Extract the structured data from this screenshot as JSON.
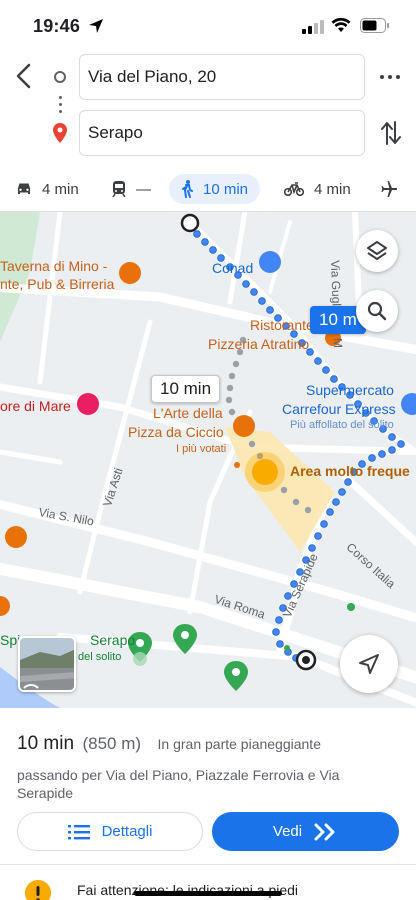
{
  "status_bar": {
    "time": "19:46"
  },
  "search": {
    "origin": "Via del Piano, 20",
    "destination": "Serapo"
  },
  "modes": {
    "car": "4 min",
    "transit": "—",
    "walk": "10 min",
    "bike": "4 min"
  },
  "map": {
    "route_time_main": "10 min",
    "route_time_alt": "10 m",
    "labels": {
      "taverna_1": "Taverna di Mino -",
      "taverna_2": "nte, Pub & Birreria",
      "conad": "Conad",
      "ristorante": "Ristorante",
      "pizzeria": "Pizzeria Atratino",
      "supermercato_1": "Supermercato",
      "supermercato_2": "Carrefour Express",
      "supermercato_3": "Più affollato del solito",
      "mare": "ore di Mare",
      "arte_1": "L'Arte della",
      "arte_2": "Pizza da Ciccio",
      "arte_3": "I più votati",
      "area": "Area molto freque",
      "serapo": "Serapo",
      "solito": "del solito",
      "spi": "Spi",
      "via_guglielmo": "Via Guglielmo M",
      "via_asti": "Via Asti",
      "via_nilo": "Via S. Nilo",
      "via_serapide": "Via Serapide",
      "corso_italia": "Corso Italia",
      "via_roma": "Via Roma"
    }
  },
  "sheet": {
    "duration": "10 min",
    "distance": "(850 m)",
    "terrain": "In gran parte pianeggiante",
    "via": "passando per Via del Piano, Piazzale Ferrovia e Via Serapide",
    "details_label": "Dettagli",
    "go_label": "Vedi",
    "warning": "Fai attenzione: le indicazioni a piedi"
  },
  "colors": {
    "accent": "#1a73e8",
    "route": "#4285f4",
    "poi_orange": "#e8710a",
    "poi_green": "#34a853",
    "poi_pink": "#e91e63"
  },
  "icons": [
    "location-arrow-icon",
    "signal-icon",
    "wifi-icon",
    "battery-icon",
    "back-arrow-icon",
    "origin-circle-icon",
    "destination-pin-icon",
    "more-dots-icon",
    "swap-icon",
    "car-icon",
    "transit-icon",
    "walk-icon",
    "bike-icon",
    "flight-icon",
    "layers-icon",
    "search-icon",
    "navigation-arrow-icon",
    "list-icon",
    "double-chevron-icon",
    "warning-icon"
  ]
}
